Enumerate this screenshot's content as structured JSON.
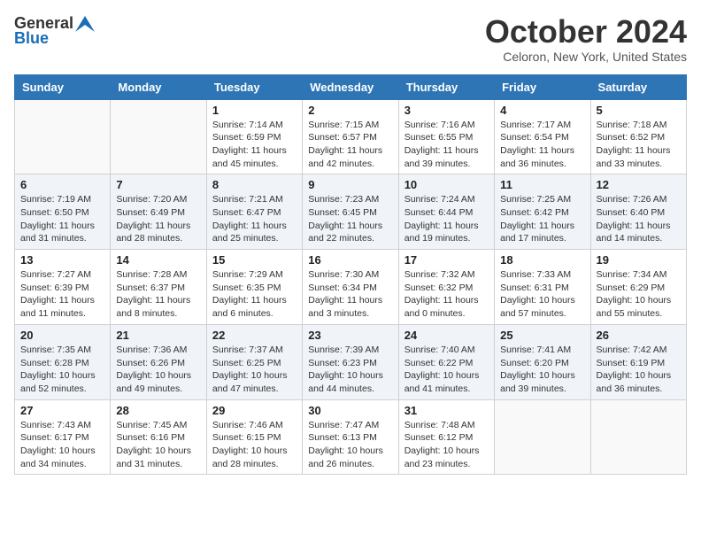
{
  "logo": {
    "general": "General",
    "blue": "Blue"
  },
  "header": {
    "month": "October 2024",
    "location": "Celoron, New York, United States"
  },
  "weekdays": [
    "Sunday",
    "Monday",
    "Tuesday",
    "Wednesday",
    "Thursday",
    "Friday",
    "Saturday"
  ],
  "weeks": [
    [
      {
        "day": "",
        "sunrise": "",
        "sunset": "",
        "daylight": ""
      },
      {
        "day": "",
        "sunrise": "",
        "sunset": "",
        "daylight": ""
      },
      {
        "day": "1",
        "sunrise": "Sunrise: 7:14 AM",
        "sunset": "Sunset: 6:59 PM",
        "daylight": "Daylight: 11 hours and 45 minutes."
      },
      {
        "day": "2",
        "sunrise": "Sunrise: 7:15 AM",
        "sunset": "Sunset: 6:57 PM",
        "daylight": "Daylight: 11 hours and 42 minutes."
      },
      {
        "day": "3",
        "sunrise": "Sunrise: 7:16 AM",
        "sunset": "Sunset: 6:55 PM",
        "daylight": "Daylight: 11 hours and 39 minutes."
      },
      {
        "day": "4",
        "sunrise": "Sunrise: 7:17 AM",
        "sunset": "Sunset: 6:54 PM",
        "daylight": "Daylight: 11 hours and 36 minutes."
      },
      {
        "day": "5",
        "sunrise": "Sunrise: 7:18 AM",
        "sunset": "Sunset: 6:52 PM",
        "daylight": "Daylight: 11 hours and 33 minutes."
      }
    ],
    [
      {
        "day": "6",
        "sunrise": "Sunrise: 7:19 AM",
        "sunset": "Sunset: 6:50 PM",
        "daylight": "Daylight: 11 hours and 31 minutes."
      },
      {
        "day": "7",
        "sunrise": "Sunrise: 7:20 AM",
        "sunset": "Sunset: 6:49 PM",
        "daylight": "Daylight: 11 hours and 28 minutes."
      },
      {
        "day": "8",
        "sunrise": "Sunrise: 7:21 AM",
        "sunset": "Sunset: 6:47 PM",
        "daylight": "Daylight: 11 hours and 25 minutes."
      },
      {
        "day": "9",
        "sunrise": "Sunrise: 7:23 AM",
        "sunset": "Sunset: 6:45 PM",
        "daylight": "Daylight: 11 hours and 22 minutes."
      },
      {
        "day": "10",
        "sunrise": "Sunrise: 7:24 AM",
        "sunset": "Sunset: 6:44 PM",
        "daylight": "Daylight: 11 hours and 19 minutes."
      },
      {
        "day": "11",
        "sunrise": "Sunrise: 7:25 AM",
        "sunset": "Sunset: 6:42 PM",
        "daylight": "Daylight: 11 hours and 17 minutes."
      },
      {
        "day": "12",
        "sunrise": "Sunrise: 7:26 AM",
        "sunset": "Sunset: 6:40 PM",
        "daylight": "Daylight: 11 hours and 14 minutes."
      }
    ],
    [
      {
        "day": "13",
        "sunrise": "Sunrise: 7:27 AM",
        "sunset": "Sunset: 6:39 PM",
        "daylight": "Daylight: 11 hours and 11 minutes."
      },
      {
        "day": "14",
        "sunrise": "Sunrise: 7:28 AM",
        "sunset": "Sunset: 6:37 PM",
        "daylight": "Daylight: 11 hours and 8 minutes."
      },
      {
        "day": "15",
        "sunrise": "Sunrise: 7:29 AM",
        "sunset": "Sunset: 6:35 PM",
        "daylight": "Daylight: 11 hours and 6 minutes."
      },
      {
        "day": "16",
        "sunrise": "Sunrise: 7:30 AM",
        "sunset": "Sunset: 6:34 PM",
        "daylight": "Daylight: 11 hours and 3 minutes."
      },
      {
        "day": "17",
        "sunrise": "Sunrise: 7:32 AM",
        "sunset": "Sunset: 6:32 PM",
        "daylight": "Daylight: 11 hours and 0 minutes."
      },
      {
        "day": "18",
        "sunrise": "Sunrise: 7:33 AM",
        "sunset": "Sunset: 6:31 PM",
        "daylight": "Daylight: 10 hours and 57 minutes."
      },
      {
        "day": "19",
        "sunrise": "Sunrise: 7:34 AM",
        "sunset": "Sunset: 6:29 PM",
        "daylight": "Daylight: 10 hours and 55 minutes."
      }
    ],
    [
      {
        "day": "20",
        "sunrise": "Sunrise: 7:35 AM",
        "sunset": "Sunset: 6:28 PM",
        "daylight": "Daylight: 10 hours and 52 minutes."
      },
      {
        "day": "21",
        "sunrise": "Sunrise: 7:36 AM",
        "sunset": "Sunset: 6:26 PM",
        "daylight": "Daylight: 10 hours and 49 minutes."
      },
      {
        "day": "22",
        "sunrise": "Sunrise: 7:37 AM",
        "sunset": "Sunset: 6:25 PM",
        "daylight": "Daylight: 10 hours and 47 minutes."
      },
      {
        "day": "23",
        "sunrise": "Sunrise: 7:39 AM",
        "sunset": "Sunset: 6:23 PM",
        "daylight": "Daylight: 10 hours and 44 minutes."
      },
      {
        "day": "24",
        "sunrise": "Sunrise: 7:40 AM",
        "sunset": "Sunset: 6:22 PM",
        "daylight": "Daylight: 10 hours and 41 minutes."
      },
      {
        "day": "25",
        "sunrise": "Sunrise: 7:41 AM",
        "sunset": "Sunset: 6:20 PM",
        "daylight": "Daylight: 10 hours and 39 minutes."
      },
      {
        "day": "26",
        "sunrise": "Sunrise: 7:42 AM",
        "sunset": "Sunset: 6:19 PM",
        "daylight": "Daylight: 10 hours and 36 minutes."
      }
    ],
    [
      {
        "day": "27",
        "sunrise": "Sunrise: 7:43 AM",
        "sunset": "Sunset: 6:17 PM",
        "daylight": "Daylight: 10 hours and 34 minutes."
      },
      {
        "day": "28",
        "sunrise": "Sunrise: 7:45 AM",
        "sunset": "Sunset: 6:16 PM",
        "daylight": "Daylight: 10 hours and 31 minutes."
      },
      {
        "day": "29",
        "sunrise": "Sunrise: 7:46 AM",
        "sunset": "Sunset: 6:15 PM",
        "daylight": "Daylight: 10 hours and 28 minutes."
      },
      {
        "day": "30",
        "sunrise": "Sunrise: 7:47 AM",
        "sunset": "Sunset: 6:13 PM",
        "daylight": "Daylight: 10 hours and 26 minutes."
      },
      {
        "day": "31",
        "sunrise": "Sunrise: 7:48 AM",
        "sunset": "Sunset: 6:12 PM",
        "daylight": "Daylight: 10 hours and 23 minutes."
      },
      {
        "day": "",
        "sunrise": "",
        "sunset": "",
        "daylight": ""
      },
      {
        "day": "",
        "sunrise": "",
        "sunset": "",
        "daylight": ""
      }
    ]
  ]
}
